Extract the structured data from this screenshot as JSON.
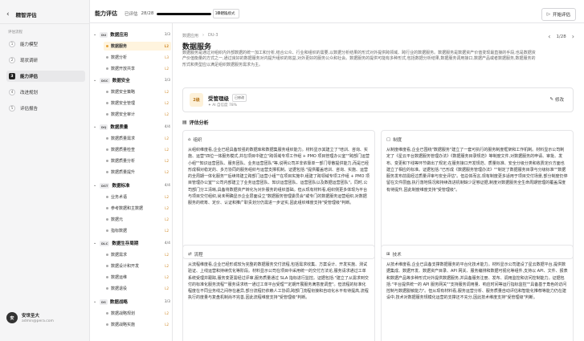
{
  "sidebar": {
    "title": "精智评估",
    "section_label": "评估流程",
    "steps": [
      {
        "num": "1",
        "label": "能力模型"
      },
      {
        "num": "2",
        "label": "现状调研"
      },
      {
        "num": "3",
        "label": "能力评估"
      },
      {
        "num": "4",
        "label": "改进规划"
      },
      {
        "num": "5",
        "label": "评估报告"
      }
    ],
    "user": {
      "initials": "安",
      "name": "安世圣大",
      "email": "admin@pera.com"
    }
  },
  "topbar": {
    "title": "能力评估",
    "progress_label": "已评估",
    "progress_count": "28/28",
    "progress_percent": "100%",
    "progress_fraction": 1.0,
    "mode_label": "单组选模式",
    "start_label": "开始评估"
  },
  "tree": {
    "categories": [
      {
        "label": "数据应用",
        "code": "DU",
        "count": "3/3",
        "items": [
          {
            "label": "数据服务",
            "level": "L2",
            "active": true
          },
          {
            "label": "数据分析",
            "level": "L3"
          },
          {
            "label": "数据开放共享",
            "level": "L2"
          }
        ]
      },
      {
        "label": "数据安全",
        "code": "DSC",
        "count": "3/3",
        "items": [
          {
            "label": "数据安全策略",
            "level": "L2"
          },
          {
            "label": "数据安全管理",
            "level": "L2"
          },
          {
            "label": "数据安全审计",
            "level": "L2"
          }
        ]
      },
      {
        "label": "数据质量",
        "code": "DQ",
        "count": "4/4",
        "items": [
          {
            "label": "数据质量需求",
            "level": "L2"
          },
          {
            "label": "数据质量检查",
            "level": "L2"
          },
          {
            "label": "数据质量分析",
            "level": "L2"
          },
          {
            "label": "数据质量提升",
            "level": "L2"
          }
        ]
      },
      {
        "label": "数据标准",
        "code": "DST",
        "count": "4/4",
        "items": [
          {
            "label": "业务术语",
            "level": "L2"
          },
          {
            "label": "参考数据和主数据",
            "level": "L2"
          },
          {
            "label": "数据元",
            "level": "L2"
          },
          {
            "label": "指标数据",
            "level": "L2"
          }
        ]
      },
      {
        "label": "数据生存周期",
        "code": "DLC",
        "count": "4/4",
        "items": [
          {
            "label": "数据需求",
            "level": "L2"
          },
          {
            "label": "数据设计和开发",
            "level": "L2"
          },
          {
            "label": "数据运维",
            "level": "L2"
          },
          {
            "label": "数据退役",
            "level": "L2"
          }
        ]
      },
      {
        "label": "数据战略",
        "code": "DS",
        "count": "3/3",
        "items": [
          {
            "label": "数据战略规划",
            "level": "L2"
          },
          {
            "label": "数据战略实施",
            "level": "L2"
          }
        ]
      }
    ]
  },
  "main": {
    "breadcrumb": [
      "数据应用",
      "›",
      "DU-3"
    ],
    "title": "数据服务",
    "pager": {
      "prev": "‹",
      "text": "1/28",
      "next": "›"
    },
    "description": "数据服务是通过对组织内外部数据的统一加工和分析,结合公众、行业和组织的需要,以数据分析结果的形式对外提供跨领域、跨行业的数据服务。数据服务是数据资产价值变现最直接的手段,也是数据资产价值衡量的方式之一,通过良好的数据服务对内提升组织的效益,对外更好的服务公众和社会。数据服务的提供可能有多种形式,包括数据分析结果,数据服务调用接口,数据产品或者数据服务,数据服务的形式和类型应以满足组织数据服务需求为主。",
    "score": {
      "badge": "2级",
      "label": "受管理级",
      "tag": "已修改",
      "sub": "AI 自信度 78%",
      "edit_label": "修改"
    },
    "section_title": "评估分析",
    "cards": {
      "org": {
        "title": "组织",
        "body": "从组织维度看,企业已经具备较强的数据库和数据集服务组织能力。材料显示其建立了\"培训、咨询、实施、运营\"四位一体服务模式,并在项目中建立\"跨领域专项工作组 + PMO 项目管理办公室\"\"跨部门运营小组\"\"知识运营团队、服务团队、业务运营团队\"等,说明公司并非依靠单一部门零散提供能力,而是已经形成相对稳定的、多方协同的服务组织与运营支撑机制。证据包括:\"提供覆盖培训、咨询、实施、运营的全周期一体化服务\"\"后续将建立跨部门运营小组\"\"在项目实施中,组建了跨领域专项工作组 + PMO 项目管理办公室\"\"公司内部建立了业务运营团队、知识运营团队、运营团队以及数据运营团队\"。同时,公司部门分工清晰,具备将数据资产转化为对外服务的组织基础。但从现有材料看,组织侧更多体现为平台与项目交付组织,尚未明确显示企业层面设立\"数据服务管理委员会\"或专门的数据服务运营组织,对数据服务的统筹、定价、认证和推广职责划分仍需进一步证实,因此组织维度支持\"受管理级\"判断。"
      },
      "system": {
        "title": "制度",
        "body": "从制度维度看,企业已围绕\"数据服务\"建立了一套可执行的服务制度框架和工作机制。材料显示公司制定了《星云平台数据服务管理办法》《数据服务目录规范》等制度文件,对数据服务的申请、审批、发布、变更和下线等环节做出了规定;在服务接口开发规范、质量标准、安全分级分类和收费定价方面也建立了相应的标准。证据包括:\"已形成《数据服务管理办法》\"\"制定了数据服务目录与分级标准\"\"数据服务发布前需经过质量评审与安全评估\"。但总体而言,现有制度更多适用于项目交付场景,部分制度仍停留在文件层面,执行落地情况和持续改进机制缺少足够证据,制度对数据服务全生命周期管理的覆盖深度有待提升,因此制度维度支持\"受管理级\"。"
      },
      "process": {
        "title": "流程",
        "body": "从流程维度看,企业已经形成较为完整的数据服务交付流程,包括需求收集、方案设计、开发实施、测试验证、上线运营和持续优化等阶段。材料显示公司在项目中采用统一的交付方法论,服务请求通过工单系统受理并跟踪,服务变更需经过评审,服务质量通过 SLA 指标进行监控。证据包括:\"建立了从需求到交付的标准化服务流程\"\"服务请求统一通过工单平台受理\"\"定期开展服务满意度调查\"。但流程的标准化程度在不同业务线之间存在差异,部分流程仍依赖人工协调,跨部门流程衔接和自动化水平有待提高,流程执行的度量与复盘机制尚不完善,因此流程维度支持\"受管理级\"判断。"
      },
      "tech": {
        "title": "技术",
        "body": "从技术维度看,企业已具备支撑数据服务的平台化技术能力。材料显示公司建设了星云数据平台,提供数据集成、数据开发、数据资产目录、API 网关、服务编排和数据可视化等组件,支持以 API、文件、报表和数据产品等多种形式对外提供数据服务,并具备服务注册、发布、调用监控和访问控制能力。证据包括:\"平台提供统一的 API 服务网关\"\"支持服务调用量、响应时间等运行指标监控\"\"具备基于角色的访问控制与数据脱敏能力\"。但从现有材料看,服务运营分析、服务质量自动评估和智能化推荐等能力仍在建设中,技术对数据服务规模化运营的支撑还不充分,因此技术维度支持\"受管理级\"判断。"
      }
    }
  }
}
